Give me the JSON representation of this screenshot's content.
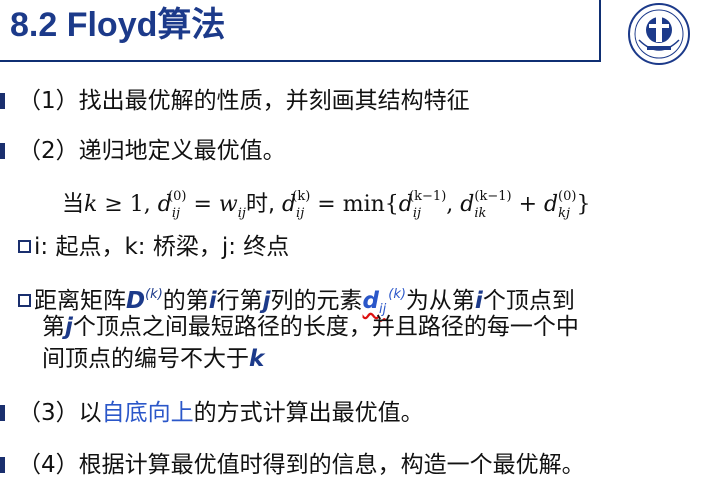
{
  "slide": {
    "title": "8.2 Floyd算法",
    "logo_icon": "university-seal-icon",
    "accent_color": "#1c3a8a",
    "highlight_color": "#2b57c9"
  },
  "items": {
    "step1": "（1）找出最优解的性质，并刻画其结构特征",
    "step2": "（2）递归地定义最优值。",
    "formula": {
      "prefix": "当",
      "k": "k",
      "cond": " ≥ 1, ",
      "d": "d",
      "sup0": "(0)",
      "supk": "(k)",
      "supk1": "(k−1)",
      "ij": "ij",
      "ik": "ik",
      "kj": "kj",
      "eq": " = ",
      "w": "w",
      "shi": "时, ",
      "min": "min",
      "lbrace": "{",
      "comma": ", ",
      "plus": " + ",
      "rbrace": "}"
    },
    "def_i": "i: 起点，k: 桥梁，j: 终点",
    "def_matrix": {
      "p1": "距离矩阵",
      "D": "D",
      "Dsup": "(k)",
      "p2": "的第",
      "i": "i",
      "p3": "行第",
      "j": "j",
      "p4": "列的元素",
      "d": "d",
      "dsub": "ij",
      "dsup": "(k)",
      "p5": "为从第",
      "i2": "i",
      "p6": "个顶点到",
      "p7": "第",
      "j2": "j",
      "p8": "个顶点之间最短路径的长度，并且路径的每一个中",
      "p9": "间顶点的编号不大于",
      "k": "k"
    },
    "step3": {
      "p1": "（3）以",
      "highlight": "自底向上",
      "p2": "的方式计算出最优值。"
    },
    "step4": "（4）根据计算最优值时得到的信息，构造一个最优解。"
  }
}
